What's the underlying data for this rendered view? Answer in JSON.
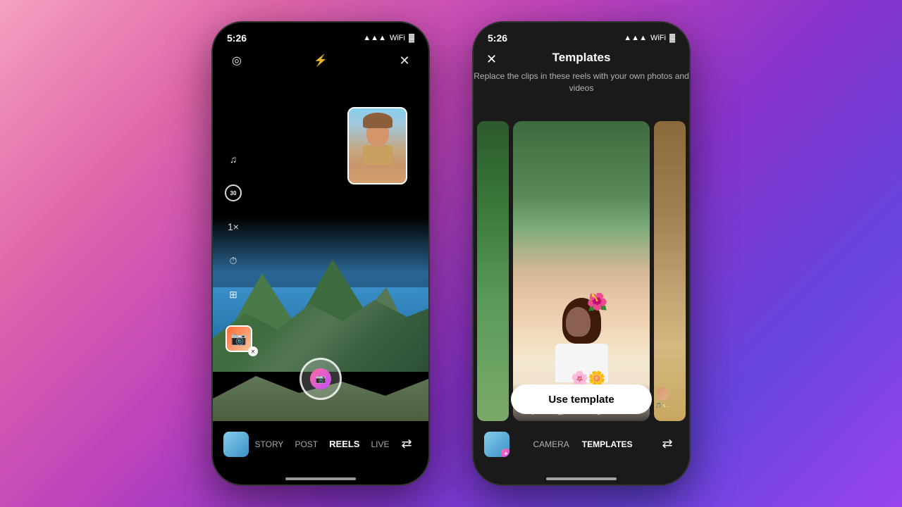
{
  "background": {
    "gradient": "linear-gradient(135deg, #f5a0c0, #e066aa, #c044bb, #8833cc, #6644dd, #9944ee)"
  },
  "phone1": {
    "status": {
      "time": "5:26",
      "signal": "▲▲▲",
      "wifi": "WiFi",
      "battery": "🔋"
    },
    "top_icons": {
      "lens_icon": "◎",
      "flash_icon": "⚡",
      "close_icon": "✕"
    },
    "left_tools": {
      "music_icon": "♫",
      "timer_label": "30",
      "speed_label": "1×",
      "clock_icon": "⏱",
      "layout_icon": "⊞"
    },
    "bottom_nav": {
      "tabs": [
        "STORY",
        "POST",
        "REELS",
        "LIVE"
      ],
      "active_tab": "REELS"
    }
  },
  "phone2": {
    "status": {
      "time": "5:26"
    },
    "header": {
      "title": "Templates",
      "subtitle": "Replace the clips in these reels with your\nown photos and videos",
      "close_label": "✕"
    },
    "main_card": {
      "username": "princess_peace",
      "audio_icon": "🎵",
      "audio_text": "princess_peace · Original Audio"
    },
    "side_card": {
      "audio_icon": "🎵",
      "audio_text": "s..."
    },
    "use_template_button": "Use template",
    "bottom_nav": {
      "tabs": [
        "CAMERA",
        "TEMPLATES"
      ],
      "active_tab": "TEMPLATES"
    }
  }
}
